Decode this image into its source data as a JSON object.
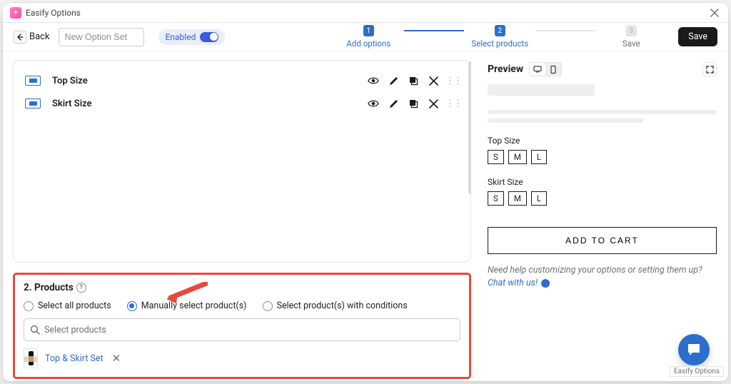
{
  "app_title": "Easify Options",
  "header": {
    "back": "Back",
    "name_placeholder": "New Option Set",
    "enabled": "Enabled",
    "steps": [
      {
        "n": "1",
        "label": "Add options"
      },
      {
        "n": "2",
        "label": "Select products"
      },
      {
        "n": "3",
        "label": "Save"
      }
    ],
    "save": "Save"
  },
  "options": [
    {
      "name": "Top Size"
    },
    {
      "name": "Skirt Size"
    }
  ],
  "products": {
    "title": "2. Products",
    "radios": {
      "all": "Select all products",
      "manual": "Manually select product(s)",
      "cond": "Select product(s) with conditions"
    },
    "search_placeholder": "Select products",
    "selected": [
      {
        "name": "Top & Skirt Set"
      }
    ]
  },
  "preview": {
    "title": "Preview",
    "opts": [
      {
        "label": "Top Size",
        "vals": [
          "S",
          "M",
          "L"
        ]
      },
      {
        "label": "Skirt Size",
        "vals": [
          "S",
          "M",
          "L"
        ]
      }
    ],
    "atc": "ADD TO CART",
    "help_pre": "Need help customizing your options or setting them up?",
    "help_link": "Chat with us!"
  },
  "chat_label": "Easify Options"
}
